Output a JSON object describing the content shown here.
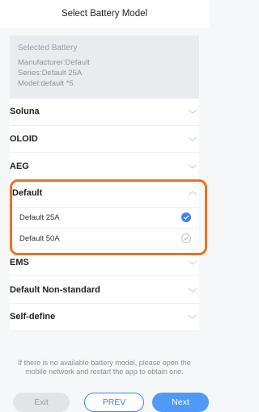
{
  "header": {
    "title": "Select Battery Model"
  },
  "selected": {
    "title": "Selected Battery",
    "manufacturer": "Manufacturer:Default",
    "series": "Series:Default 25A",
    "model": "Model:default *5"
  },
  "list": {
    "items": [
      {
        "label": "Soluna"
      },
      {
        "label": "OLOID"
      },
      {
        "label": "AEG"
      },
      {
        "label": "Default"
      },
      {
        "label": "EMS"
      },
      {
        "label": "Default Non-standard"
      },
      {
        "label": "Self-define"
      }
    ],
    "default_subitems": [
      {
        "label": "Default 25A",
        "selected": true
      },
      {
        "label": "Default 50A",
        "selected": false
      }
    ]
  },
  "footer": {
    "note": "If there is no available battery model, please open the mobile network and restart the app to obtain one.",
    "exit_label": "Exit",
    "prev_label": "PREV",
    "next_label": "Next"
  },
  "colors": {
    "accent": "#4f9af7",
    "highlight": "#f07020"
  }
}
